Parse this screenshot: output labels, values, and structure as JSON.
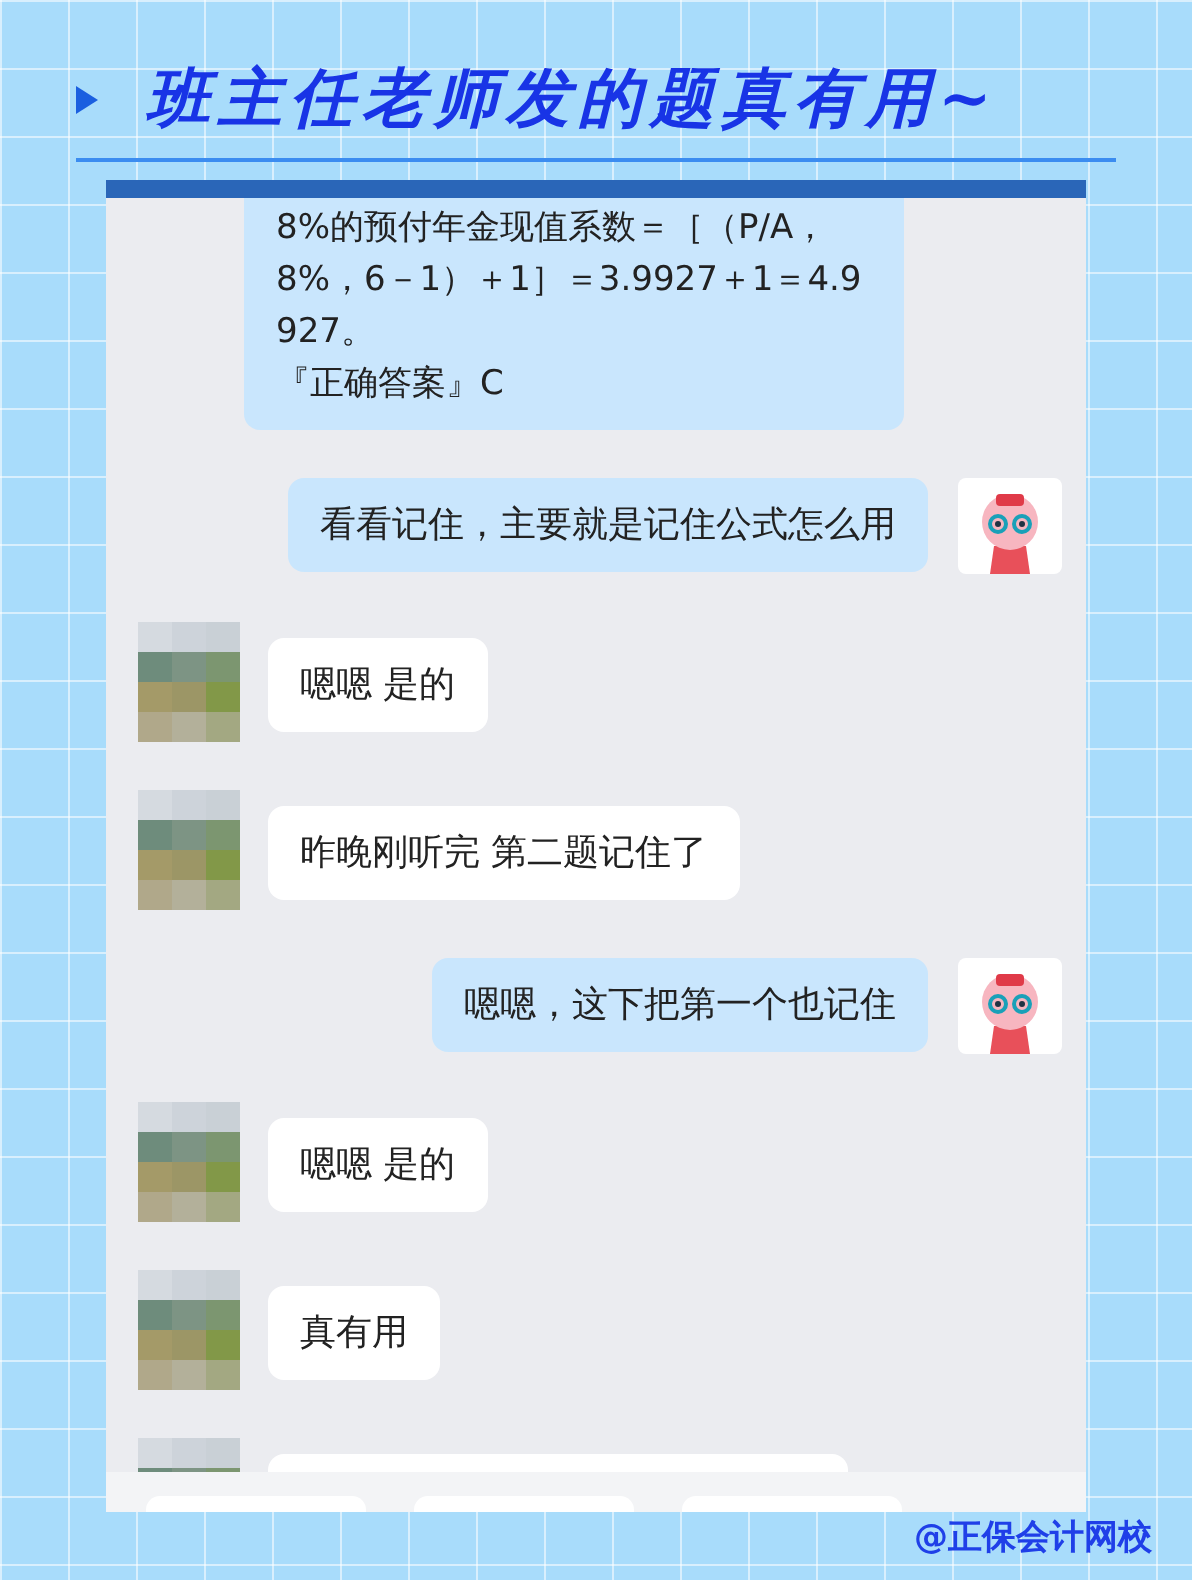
{
  "title": "班主任老师发的题真有用~",
  "chat": {
    "top_message": {
      "lines": [
        "8%的预付年金现值系数＝［（P/A，8%，6－1）＋1］＝3.9927＋1＝4.9927。",
        "『正确答案』C"
      ]
    },
    "messages": [
      {
        "kind": "sent",
        "text": "看看记住，主要就是记住公式怎么用"
      },
      {
        "kind": "received",
        "text": "嗯嗯 是的"
      },
      {
        "kind": "received",
        "text": "昨晚刚听完 第二题记住了"
      },
      {
        "kind": "sent",
        "text": "嗯嗯，这下把第一个也记住"
      },
      {
        "kind": "received",
        "text": "嗯嗯 是的"
      },
      {
        "kind": "received",
        "text": "真有用"
      },
      {
        "kind": "received"
      }
    ]
  },
  "credit": "@正保会计网校"
}
